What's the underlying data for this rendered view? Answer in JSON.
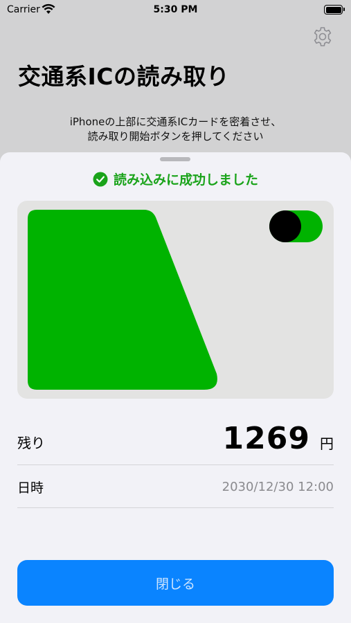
{
  "status_bar": {
    "carrier": "Carrier",
    "time": "5:30 PM"
  },
  "header": {
    "settings_icon": "gear-icon",
    "title": "交通系ICの読み取り",
    "instruction_line1": "iPhoneの上部に交通系ICカードを密着させ、",
    "instruction_line2": "読み取り開始ボタンを押してください"
  },
  "sheet": {
    "status_icon": "checkmark-circle-icon",
    "status_text": "読み込みに成功しました",
    "status_color": "#1aa31a",
    "card": {
      "card_color": "#00b300",
      "background_color": "#e3e3e2"
    },
    "balance": {
      "label": "残り",
      "amount": "1269",
      "unit": "円"
    },
    "datetime": {
      "label": "日時",
      "value": "2030/12/30 12:00"
    },
    "close_button": {
      "label": "閉じる",
      "color": "#0a84ff"
    }
  }
}
